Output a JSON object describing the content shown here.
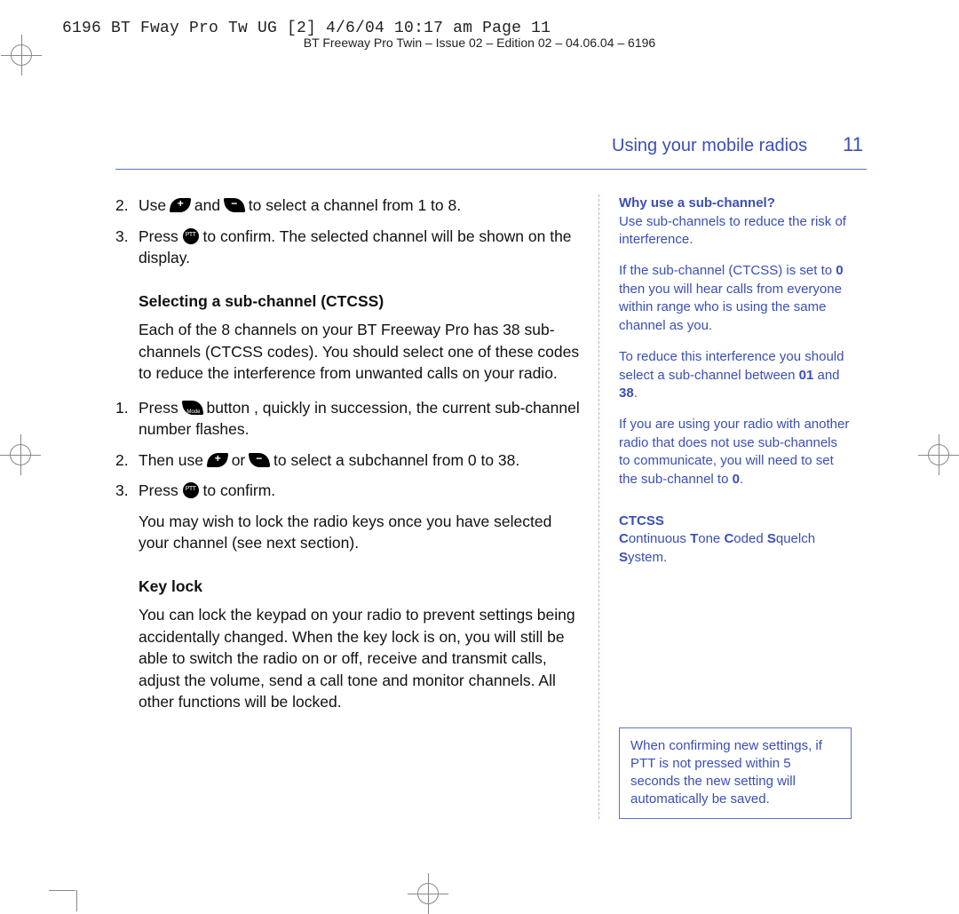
{
  "slug_line": "6196 BT Fway Pro Tw UG [2]  4/6/04  10:17 am  Page 11",
  "header": "BT Freeway Pro Twin – Issue 02 – Edition 02 – 04.06.04 – 6196",
  "running_head": "Using your mobile radios",
  "page_number": "11",
  "main": {
    "step2_a": "Use ",
    "step2_b": " and ",
    "step2_c": " to select a channel from 1 to 8.",
    "step3_a": "Press ",
    "step3_b": " to confirm. The selected channel will be shown on the display.",
    "heading_subchannel": "Selecting a sub-channel (CTCSS)",
    "sub_intro": "Each of the 8 channels on your BT Freeway Pro has 38 sub-channels (CTCSS codes). You should select one of these codes to reduce the interference from unwanted calls on your radio.",
    "sub_step1_a": "Press ",
    "sub_step1_b": " button        , quickly in succession, the current sub-channel number flashes.",
    "sub_step2_a": "Then use ",
    "sub_step2_b": " or ",
    "sub_step2_c": " to select a subchannel from 0 to 38.",
    "sub_step3_a": "Press ",
    "sub_step3_b": " to confirm.",
    "sub_after": "You may wish to lock the radio keys once you have selected your channel (see next section).",
    "heading_keylock": "Key lock",
    "keylock_body": "You can lock the keypad on your radio to prevent settings being accidentally changed. When the key lock is on, you will still be able to switch the radio on or off, receive and transmit calls, adjust the volume, send a call tone and monitor channels. All other functions will be locked.",
    "n2": "2.",
    "n3": "3.",
    "n1": "1."
  },
  "side": {
    "why_head": "Why use a sub-channel?",
    "why_p1": "Use sub-channels to reduce the risk of interference.",
    "why_p2_a": "If the sub-channel (CTCSS) is set to ",
    "why_p2_zero": "0",
    "why_p2_b": " then you will hear calls from everyone within range who is using the same channel as you.",
    "why_p3_a": "To reduce this interference you should select a sub-channel between ",
    "why_p3_01": "01",
    "why_p3_and": " and ",
    "why_p3_38": "38",
    "why_p3_end": ".",
    "why_p4_a": "If you are using your radio with another radio that does not use sub-channels to communicate, you will need to set the sub-channel to ",
    "why_p4_zero": "0",
    "why_p4_end": ".",
    "ctcss_head": "CTCSS",
    "ctcss_body_C": "C",
    "ctcss_body_1": "ontinuous ",
    "ctcss_body_T": "T",
    "ctcss_body_2": "one ",
    "ctcss_body_C2": "C",
    "ctcss_body_3": "oded ",
    "ctcss_body_S": "S",
    "ctcss_body_4": "quelch ",
    "ctcss_body_S2": "S",
    "ctcss_body_5": "ystem.",
    "notebox": "When confirming new settings, if PTT is not pressed within 5 seconds the new setting will automatically be saved."
  },
  "icons": {
    "plus_symbol": "+",
    "minus_symbol": "−",
    "ptt_label": "PTT",
    "mode_label": "Mode"
  }
}
